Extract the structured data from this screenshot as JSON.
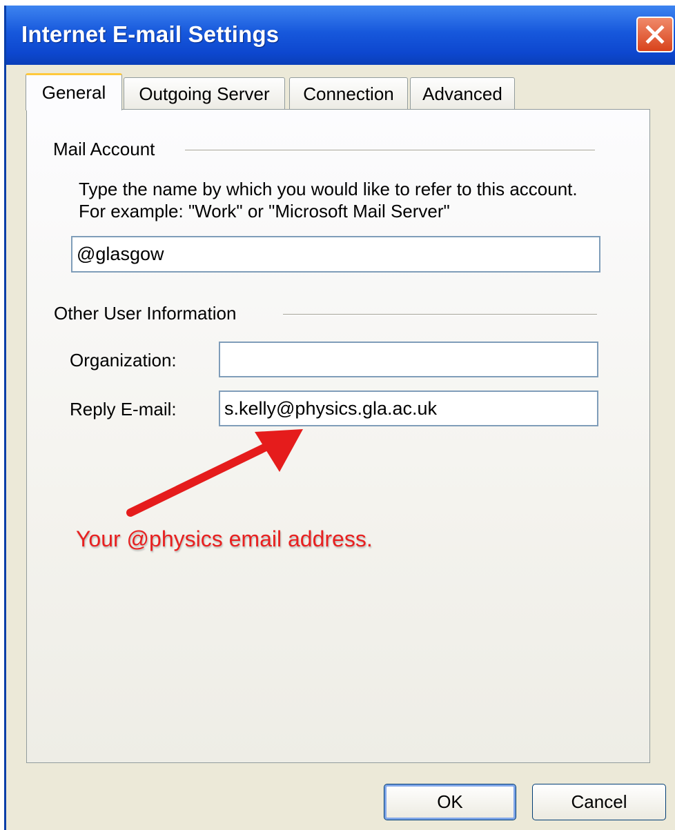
{
  "window": {
    "title": "Internet E-mail Settings",
    "close_icon": "close-icon",
    "accent_color": "#0d47cf"
  },
  "tabs": [
    {
      "label": "General",
      "active": true
    },
    {
      "label": "Outgoing Server",
      "active": false
    },
    {
      "label": "Connection",
      "active": false
    },
    {
      "label": "Advanced",
      "active": false
    }
  ],
  "mail_account": {
    "heading": "Mail Account",
    "description": "Type the name by which you would like to refer to this account.  For example: \"Work\" or \"Microsoft Mail Server\"",
    "account_name_value": "@glasgow"
  },
  "other_info": {
    "heading": "Other User Information",
    "organization_label": "Organization:",
    "organization_value": "",
    "reply_email_label": "Reply E-mail:",
    "reply_email_value": "s.kelly@physics.gla.ac.uk"
  },
  "annotation": {
    "text": "Your @physics email address.",
    "color": "#e82020"
  },
  "buttons": {
    "ok": "OK",
    "cancel": "Cancel"
  }
}
